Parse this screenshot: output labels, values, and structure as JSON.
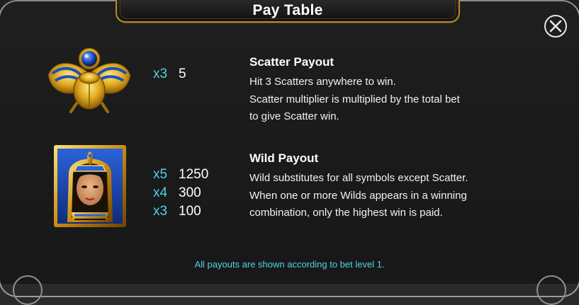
{
  "header": {
    "title": "Pay Table"
  },
  "close_button": {
    "icon": "close-icon"
  },
  "scatter": {
    "symbol_icon": "scarab-icon",
    "pays": [
      {
        "mult": "x3",
        "value": "5"
      }
    ],
    "heading": "Scatter Payout",
    "lines": [
      "Hit 3 Scatters anywhere to win.",
      "Scatter multiplier is multiplied by the total bet",
      "to give Scatter win."
    ]
  },
  "wild": {
    "symbol_icon": "queen-portrait-icon",
    "pays": [
      {
        "mult": "x5",
        "value": "1250"
      },
      {
        "mult": "x4",
        "value": "300"
      },
      {
        "mult": "x3",
        "value": "100"
      }
    ],
    "heading": "Wild Payout",
    "lines": [
      "Wild substitutes for all symbols except Scatter.",
      "When one or more Wilds appears in a winning",
      "combination, only the highest win is paid."
    ]
  },
  "footnote": "All payouts are shown according to bet level 1.",
  "colors": {
    "accent": "#4fd3e6",
    "gold": "#b58a2e",
    "background": "#1c1c1c"
  }
}
